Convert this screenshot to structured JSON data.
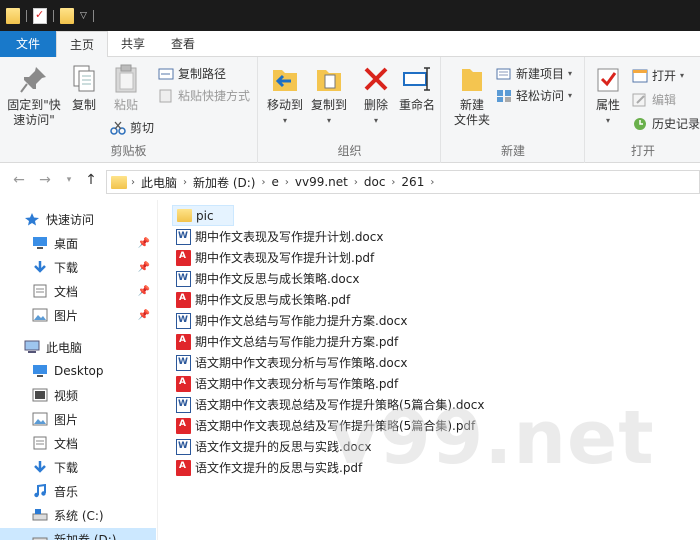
{
  "tabs": [
    "文件",
    "主页",
    "共享",
    "查看"
  ],
  "ribbon": {
    "clipboard": {
      "pin_label_1": "固定到\"快",
      "pin_label_2": "速访问\"",
      "copy": "复制",
      "paste": "粘贴",
      "copy_path": "复制路径",
      "paste_shortcut": "粘贴快捷方式",
      "cut": "剪切",
      "group": "剪贴板"
    },
    "organize": {
      "move_to": "移动到",
      "copy_to": "复制到",
      "delete": "删除",
      "rename": "重命名",
      "group": "组织"
    },
    "new": {
      "new_folder_1": "新建",
      "new_folder_2": "文件夹",
      "new_item": "新建项目",
      "easy_access": "轻松访问",
      "group": "新建"
    },
    "open": {
      "properties": "属性",
      "open": "打开",
      "edit": "编辑",
      "history": "历史记录",
      "group": "打开"
    }
  },
  "address": {
    "crumbs": [
      "此电脑",
      "新加卷 (D:)",
      "e",
      "vv99.net",
      "doc",
      "261"
    ]
  },
  "nav": {
    "quick_access": "快速访问",
    "quick": [
      {
        "label": "桌面",
        "icon": "desktop-icon"
      },
      {
        "label": "下载",
        "icon": "download-icon"
      },
      {
        "label": "文档",
        "icon": "document-icon"
      },
      {
        "label": "图片",
        "icon": "picture-icon"
      }
    ],
    "this_pc": "此电脑",
    "pc": [
      {
        "label": "Desktop",
        "icon": "desktop-icon"
      },
      {
        "label": "视频",
        "icon": "video-icon"
      },
      {
        "label": "图片",
        "icon": "picture-icon"
      },
      {
        "label": "文档",
        "icon": "document-icon"
      },
      {
        "label": "下载",
        "icon": "download-icon"
      },
      {
        "label": "音乐",
        "icon": "music-icon"
      },
      {
        "label": "系统 (C:)",
        "icon": "drive-icon"
      },
      {
        "label": "新加卷 (D:)",
        "icon": "drive-icon"
      }
    ]
  },
  "files": [
    {
      "name": "pic",
      "type": "folder"
    },
    {
      "name": "期中作文表现及写作提升计划.docx",
      "type": "docx"
    },
    {
      "name": "期中作文表现及写作提升计划.pdf",
      "type": "pdf"
    },
    {
      "name": "期中作文反思与成长策略.docx",
      "type": "docx"
    },
    {
      "name": "期中作文反思与成长策略.pdf",
      "type": "pdf"
    },
    {
      "name": "期中作文总结与写作能力提升方案.docx",
      "type": "docx"
    },
    {
      "name": "期中作文总结与写作能力提升方案.pdf",
      "type": "pdf"
    },
    {
      "name": "语文期中作文表现分析与写作策略.docx",
      "type": "docx"
    },
    {
      "name": "语文期中作文表现分析与写作策略.pdf",
      "type": "pdf"
    },
    {
      "name": "语文期中作文表现总结及写作提升策略(5篇合集).docx",
      "type": "docx"
    },
    {
      "name": "语文期中作文表现总结及写作提升策略(5篇合集).pdf",
      "type": "pdf"
    },
    {
      "name": "语文作文提升的反思与实践.docx",
      "type": "docx"
    },
    {
      "name": "语文作文提升的反思与实践.pdf",
      "type": "pdf"
    }
  ],
  "watermark": "v99.net",
  "colors": {
    "file_tab": "#1979ca",
    "selection": "#cce8ff"
  }
}
